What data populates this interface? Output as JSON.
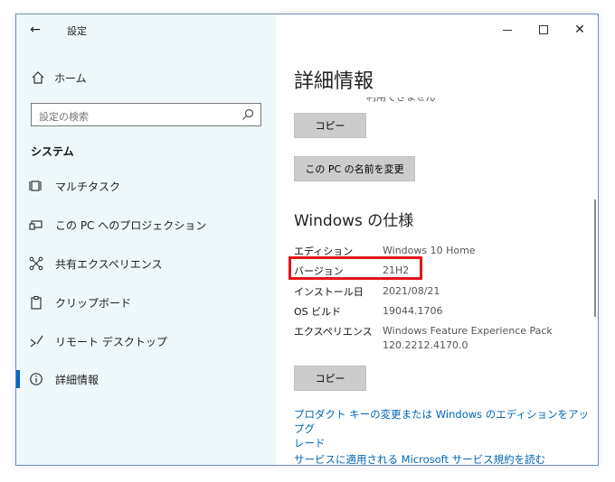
{
  "window": {
    "title": "設定"
  },
  "sidebar": {
    "home_label": "ホーム",
    "search_placeholder": "設定の検索",
    "section_title": "システム",
    "items": [
      {
        "label": "マルチタスク",
        "icon": "multitask-icon"
      },
      {
        "label": "この PC へのプロジェクション",
        "icon": "projection-icon"
      },
      {
        "label": "共有エクスペリエンス",
        "icon": "shared-experience-icon"
      },
      {
        "label": "クリップボード",
        "icon": "clipboard-icon"
      },
      {
        "label": "リモート デスクトップ",
        "icon": "remote-desktop-icon"
      },
      {
        "label": "詳細情報",
        "icon": "info-icon",
        "active": true
      }
    ]
  },
  "main": {
    "title": "詳細情報",
    "scroll_clipped_text": "利用できません",
    "copy_label_1": "コピー",
    "rename_label": "この PC の名前を変更",
    "spec_title": "Windows の仕様",
    "specs": [
      {
        "key": "エディション",
        "value": "Windows 10 Home"
      },
      {
        "key": "バージョン",
        "value": "21H2"
      },
      {
        "key": "インストール日",
        "value": "2021/08/21"
      },
      {
        "key": "OS ビルド",
        "value": "19044.1706"
      },
      {
        "key": "エクスペリエンス",
        "value": "Windows Feature Experience Pack",
        "value2": "120.2212.4170.0"
      }
    ],
    "copy_label_2": "コピー",
    "link_product_key_1": "プロダクト キーの変更または Windows のエディションをアップグ",
    "link_product_key_2": "レード",
    "link_services": "サービスに適用される Microsoft サービス規約を読む"
  },
  "colors": {
    "accent": "#0067c0",
    "link": "#0066b4",
    "highlight_border": "#e5141b",
    "sidebar_bg": "#eef7f9",
    "button_bg": "#cccccc"
  }
}
